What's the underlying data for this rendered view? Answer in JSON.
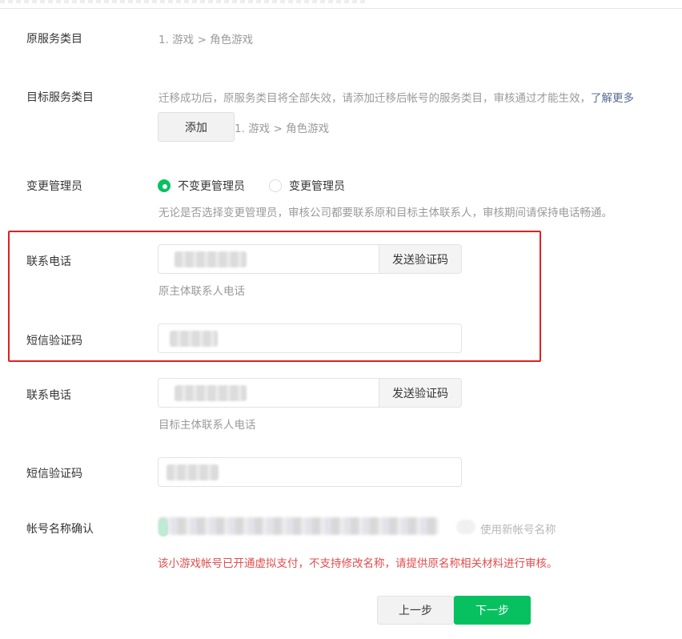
{
  "form": {
    "original_category": {
      "label": "原服务类目",
      "value": "1. 游戏 > 角色游戏"
    },
    "target_category": {
      "label": "目标服务类目",
      "hint": "迁移成功后，原服务类目将全部失效，请添加迁移后帐号的服务类目，审核通过才能生效，",
      "learn_more": "了解更多",
      "add_button": "添加",
      "value": "1. 游戏 > 角色游戏"
    },
    "change_admin": {
      "label": "变更管理员",
      "option_keep": "不变更管理员",
      "option_change": "变更管理员",
      "selected": "不变更管理员",
      "hint": "无论是否选择变更管理员，审核公司都要联系原和目标主体联系人，审核期间请保持电话畅通。"
    },
    "original_contact": {
      "phone_label": "联系电话",
      "send_code": "发送验证码",
      "phone_hint": "原主体联系人电话",
      "sms_label": "短信验证码"
    },
    "target_contact": {
      "phone_label": "联系电话",
      "send_code": "发送验证码",
      "phone_hint": "目标主体联系人电话",
      "sms_label": "短信验证码"
    },
    "account_name": {
      "label": "帐号名称确认",
      "option_new": "使用新帐号名称",
      "warning": "该小游戏帐号已开通虚拟支付，不支持修改名称，请提供原名称相关材料进行审核。"
    },
    "actions": {
      "prev": "上一步",
      "next": "下一步"
    }
  },
  "colors": {
    "accent": "#07c160",
    "highlight_box": "#e02020",
    "warning_text": "#e34d4d",
    "link": "#576b95"
  }
}
